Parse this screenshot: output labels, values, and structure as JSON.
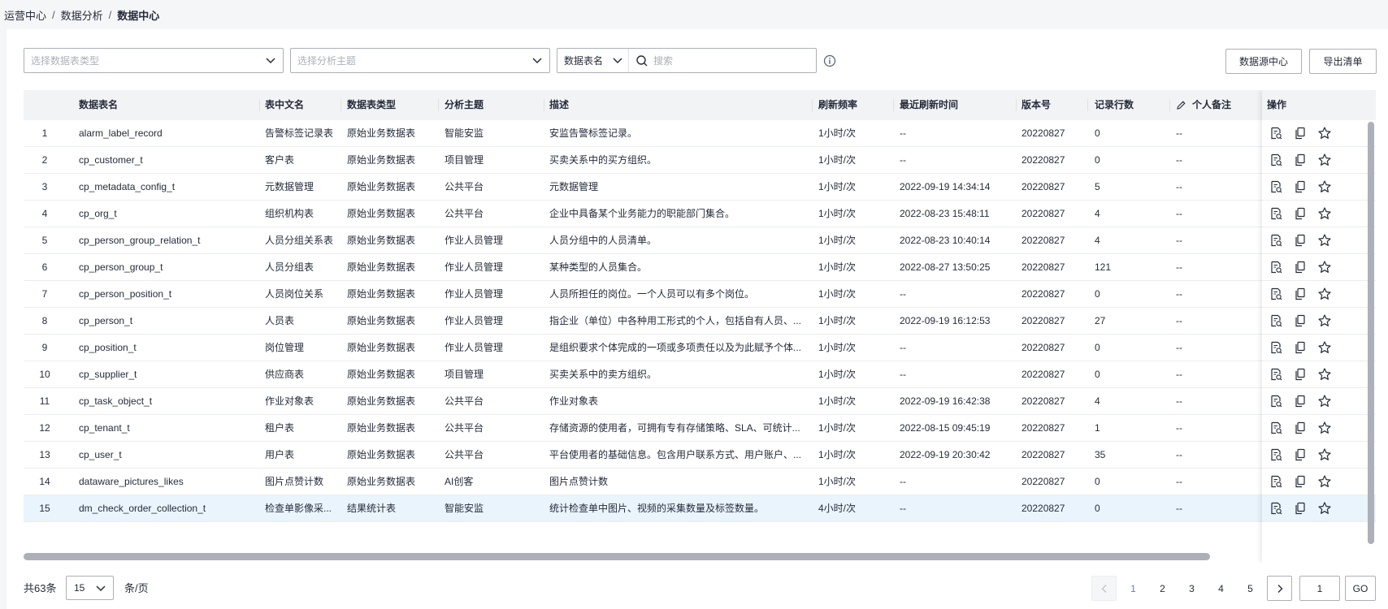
{
  "breadcrumb": {
    "items": [
      "运营中心",
      "数据分析",
      "数据中心"
    ],
    "separator": "/"
  },
  "filters": {
    "table_type_placeholder": "选择数据表类型",
    "topic_placeholder": "选择分析主题",
    "search_field": "数据表名",
    "search_placeholder": "搜索"
  },
  "buttons": {
    "datasource_center": "数据源中心",
    "export_list": "导出清单"
  },
  "table": {
    "columns": [
      "数据表名",
      "表中文名",
      "数据表类型",
      "分析主题",
      "描述",
      "刷新频率",
      "最近刷新时间",
      "版本号",
      "记录行数",
      "个人备注",
      "操作"
    ],
    "rows": [
      {
        "index": "1",
        "name": "alarm_label_record",
        "cn_name": "告警标签记录表",
        "type": "原始业务数据表",
        "topic": "智能安监",
        "desc": "安监告警标签记录。",
        "freq": "1小时/次",
        "refreshed": "--",
        "version": "20220827",
        "rows": "0",
        "note": "--"
      },
      {
        "index": "2",
        "name": "cp_customer_t",
        "cn_name": "客户表",
        "type": "原始业务数据表",
        "topic": "项目管理",
        "desc": "买卖关系中的买方组织。",
        "freq": "1小时/次",
        "refreshed": "--",
        "version": "20220827",
        "rows": "0",
        "note": "--"
      },
      {
        "index": "3",
        "name": "cp_metadata_config_t",
        "cn_name": "元数据管理",
        "type": "原始业务数据表",
        "topic": "公共平台",
        "desc": "元数据管理",
        "freq": "1小时/次",
        "refreshed": "2022-09-19 14:34:14",
        "version": "20220827",
        "rows": "5",
        "note": "--"
      },
      {
        "index": "4",
        "name": "cp_org_t",
        "cn_name": "组织机构表",
        "type": "原始业务数据表",
        "topic": "公共平台",
        "desc": "企业中具备某个业务能力的职能部门集合。",
        "freq": "1小时/次",
        "refreshed": "2022-08-23 15:48:11",
        "version": "20220827",
        "rows": "4",
        "note": "--"
      },
      {
        "index": "5",
        "name": "cp_person_group_relation_t",
        "cn_name": "人员分组关系表",
        "type": "原始业务数据表",
        "topic": "作业人员管理",
        "desc": "人员分组中的人员清单。",
        "freq": "1小时/次",
        "refreshed": "2022-08-23 10:40:14",
        "version": "20220827",
        "rows": "4",
        "note": "--"
      },
      {
        "index": "6",
        "name": "cp_person_group_t",
        "cn_name": "人员分组表",
        "type": "原始业务数据表",
        "topic": "作业人员管理",
        "desc": "某种类型的人员集合。",
        "freq": "1小时/次",
        "refreshed": "2022-08-27 13:50:25",
        "version": "20220827",
        "rows": "121",
        "note": "--"
      },
      {
        "index": "7",
        "name": "cp_person_position_t",
        "cn_name": "人员岗位关系",
        "type": "原始业务数据表",
        "topic": "作业人员管理",
        "desc": "人员所担任的岗位。一个人员可以有多个岗位。",
        "freq": "1小时/次",
        "refreshed": "--",
        "version": "20220827",
        "rows": "0",
        "note": "--"
      },
      {
        "index": "8",
        "name": "cp_person_t",
        "cn_name": "人员表",
        "type": "原始业务数据表",
        "topic": "作业人员管理",
        "desc": "指企业（单位）中各种用工形式的个人，包括自有人员、...",
        "freq": "1小时/次",
        "refreshed": "2022-09-19 16:12:53",
        "version": "20220827",
        "rows": "27",
        "note": "--"
      },
      {
        "index": "9",
        "name": "cp_position_t",
        "cn_name": "岗位管理",
        "type": "原始业务数据表",
        "topic": "作业人员管理",
        "desc": "是组织要求个体完成的一项或多项责任以及为此赋予个体...",
        "freq": "1小时/次",
        "refreshed": "--",
        "version": "20220827",
        "rows": "0",
        "note": "--"
      },
      {
        "index": "10",
        "name": "cp_supplier_t",
        "cn_name": "供应商表",
        "type": "原始业务数据表",
        "topic": "项目管理",
        "desc": "买卖关系中的卖方组织。",
        "freq": "1小时/次",
        "refreshed": "--",
        "version": "20220827",
        "rows": "0",
        "note": "--"
      },
      {
        "index": "11",
        "name": "cp_task_object_t",
        "cn_name": "作业对象表",
        "type": "原始业务数据表",
        "topic": "公共平台",
        "desc": "作业对象表",
        "freq": "1小时/次",
        "refreshed": "2022-09-19 16:42:38",
        "version": "20220827",
        "rows": "4",
        "note": "--"
      },
      {
        "index": "12",
        "name": "cp_tenant_t",
        "cn_name": "租户表",
        "type": "原始业务数据表",
        "topic": "公共平台",
        "desc": "存储资源的使用者，可拥有专有存储策略、SLA、可统计...",
        "freq": "1小时/次",
        "refreshed": "2022-08-15 09:45:19",
        "version": "20220827",
        "rows": "1",
        "note": "--"
      },
      {
        "index": "13",
        "name": "cp_user_t",
        "cn_name": "用户表",
        "type": "原始业务数据表",
        "topic": "公共平台",
        "desc": "平台使用者的基础信息。包含用户联系方式、用户账户、...",
        "freq": "1小时/次",
        "refreshed": "2022-09-19 20:30:42",
        "version": "20220827",
        "rows": "35",
        "note": "--"
      },
      {
        "index": "14",
        "name": "dataware_pictures_likes",
        "cn_name": "图片点赞计数",
        "type": "原始业务数据表",
        "topic": "AI创客",
        "desc": "图片点赞计数",
        "freq": "1小时/次",
        "refreshed": "--",
        "version": "20220827",
        "rows": "0",
        "note": "--"
      },
      {
        "index": "15",
        "name": "dm_check_order_collection_t",
        "cn_name": "检查单影像采...",
        "type": "结果统计表",
        "topic": "智能安监",
        "desc": "统计检查单中图片、视频的采集数量及标签数量。",
        "freq": "4小时/次",
        "refreshed": "--",
        "version": "20220827",
        "rows": "0",
        "note": "--"
      }
    ]
  },
  "pagination": {
    "total_label": "共63条",
    "page_size": "15",
    "unit_label": "条/页",
    "pages": [
      "1",
      "2",
      "3",
      "4",
      "5"
    ],
    "current": "1",
    "jump_value": "1",
    "go_label": "GO"
  },
  "colors": {
    "accent": "#5e7ce0",
    "header_bg": "#f2f3f5",
    "highlight_row": "#e9f4fc",
    "border": "#adb0b8"
  },
  "icons": [
    "chevron-down-icon",
    "search-icon",
    "info-icon",
    "edit-icon",
    "detail-icon",
    "copy-icon",
    "star-icon",
    "chevron-left-icon",
    "chevron-right-icon"
  ]
}
